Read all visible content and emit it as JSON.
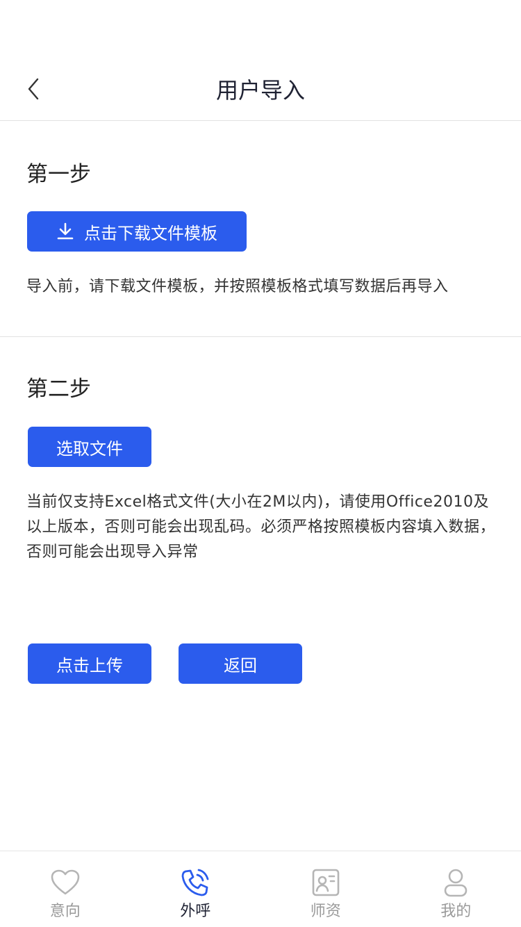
{
  "header": {
    "title": "用户导入",
    "back_icon": "chevron-left-icon"
  },
  "step1": {
    "title": "第一步",
    "download_button_label": "点击下载文件模板",
    "download_icon": "download-icon",
    "description": "导入前，请下载文件模板，并按照模板格式填写数据后再导入"
  },
  "step2": {
    "title": "第二步",
    "select_button_label": "选取文件",
    "description": "当前仅支持Excel格式文件(大小在2M以内)，请使用Office2010及以上版本，否则可能会出现乱码。必须严格按照模板内容填入数据，否则可能会出现导入异常"
  },
  "actions": {
    "upload_label": "点击上传",
    "back_label": "返回"
  },
  "tabbar": {
    "items": [
      {
        "label": "意向",
        "icon": "heart-icon",
        "active": false
      },
      {
        "label": "外呼",
        "icon": "phone-call-icon",
        "active": true
      },
      {
        "label": "师资",
        "icon": "teacher-profile-icon",
        "active": false
      },
      {
        "label": "我的",
        "icon": "user-icon",
        "active": false
      }
    ]
  },
  "colors": {
    "primary": "#2b5ced",
    "active_icon": "#2b5ced",
    "inactive": "#9a9a9a",
    "divider": "#e2e2e2"
  }
}
